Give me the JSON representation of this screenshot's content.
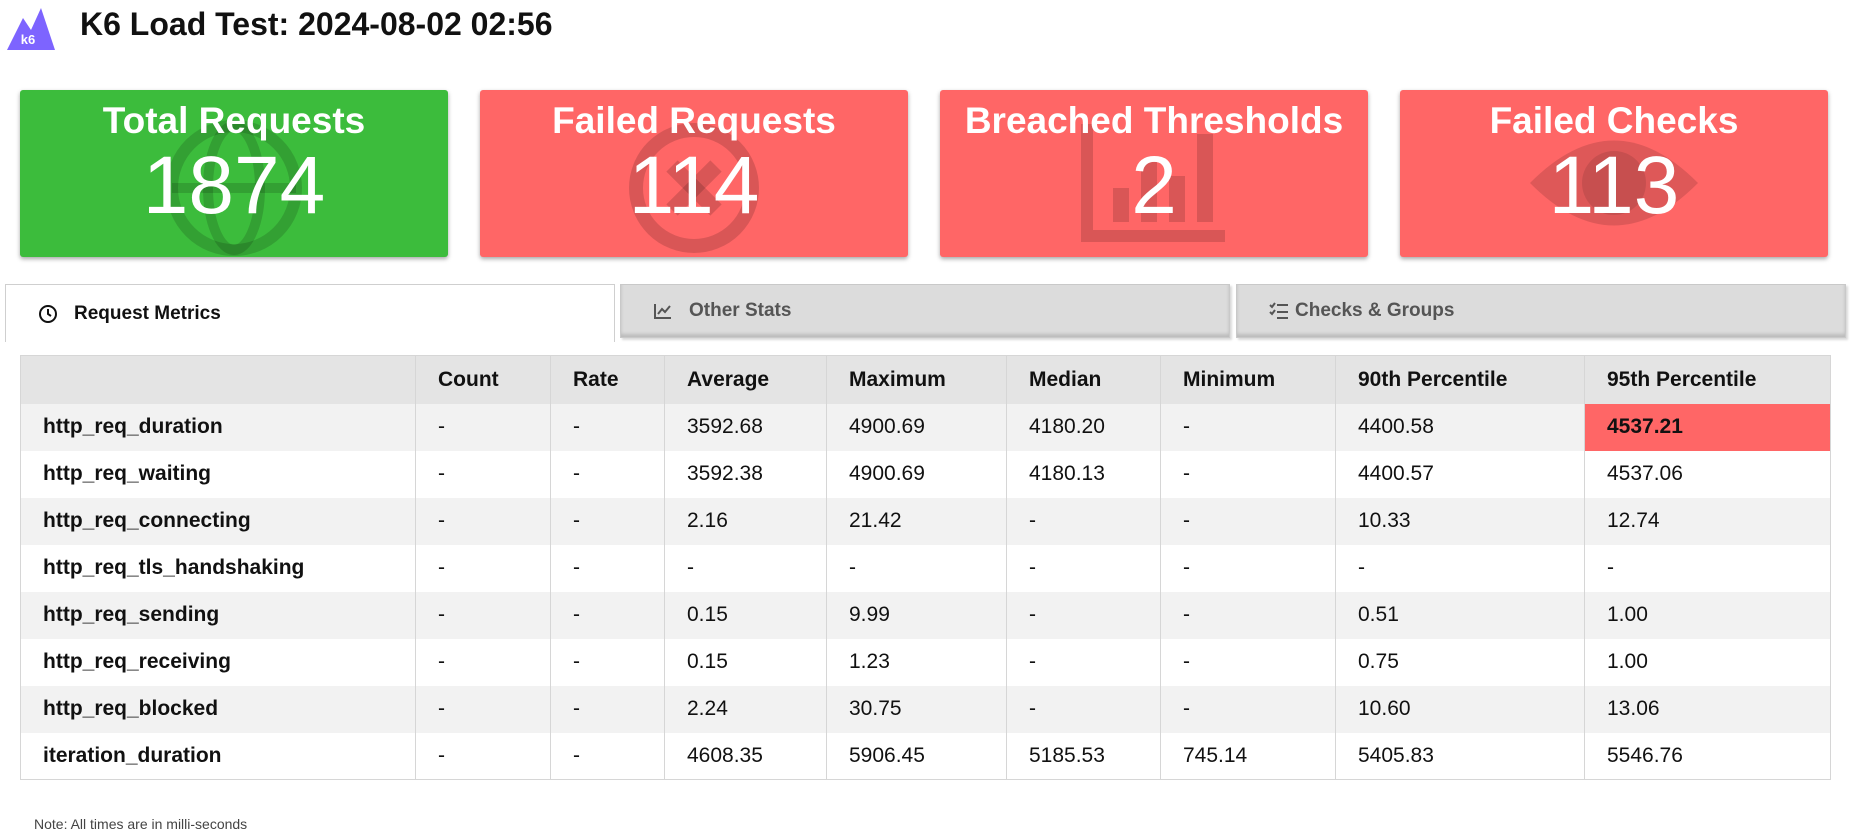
{
  "header": {
    "logo_text": "k6",
    "title": "K6 Load Test: 2024-08-02 02:56"
  },
  "cards": [
    {
      "label": "Total Requests",
      "value": "1874",
      "color": "#3cbc3c",
      "icon": "globe-icon"
    },
    {
      "label": "Failed Requests",
      "value": "114",
      "color": "#ff6666",
      "icon": "x-circle-icon"
    },
    {
      "label": "Breached Thresholds",
      "value": "2",
      "color": "#ff6666",
      "icon": "chart-icon"
    },
    {
      "label": "Failed Checks",
      "value": "113",
      "color": "#ff6666",
      "icon": "eye-icon"
    }
  ],
  "tabs": [
    {
      "label": "Request Metrics",
      "icon": "clock-icon",
      "active": true
    },
    {
      "label": "Other Stats",
      "icon": "chart-line-icon",
      "active": false
    },
    {
      "label": "Checks & Groups",
      "icon": "checklist-icon",
      "active": false
    }
  ],
  "table": {
    "columns": [
      "",
      "Count",
      "Rate",
      "Average",
      "Maximum",
      "Median",
      "Minimum",
      "90th Percentile",
      "95th Percentile"
    ],
    "rows": [
      [
        "http_req_duration",
        "-",
        "-",
        "3592.68",
        "4900.69",
        "4180.20",
        "-",
        "4400.58",
        "4537.21"
      ],
      [
        "http_req_waiting",
        "-",
        "-",
        "3592.38",
        "4900.69",
        "4180.13",
        "-",
        "4400.57",
        "4537.06"
      ],
      [
        "http_req_connecting",
        "-",
        "-",
        "2.16",
        "21.42",
        "-",
        "-",
        "10.33",
        "12.74"
      ],
      [
        "http_req_tls_handshaking",
        "-",
        "-",
        "-",
        "-",
        "-",
        "-",
        "-",
        "-"
      ],
      [
        "http_req_sending",
        "-",
        "-",
        "0.15",
        "9.99",
        "-",
        "-",
        "0.51",
        "1.00"
      ],
      [
        "http_req_receiving",
        "-",
        "-",
        "0.15",
        "1.23",
        "-",
        "-",
        "0.75",
        "1.00"
      ],
      [
        "http_req_blocked",
        "-",
        "-",
        "2.24",
        "30.75",
        "-",
        "-",
        "10.60",
        "13.06"
      ],
      [
        "iteration_duration",
        "-",
        "-",
        "4608.35",
        "5906.45",
        "5185.53",
        "745.14",
        "5405.83",
        "5546.76"
      ]
    ],
    "breached_cell": "http_req_duration / 95th Percentile",
    "breach_color": "#ff6666"
  },
  "note": "Note: All times are in milli-seconds"
}
